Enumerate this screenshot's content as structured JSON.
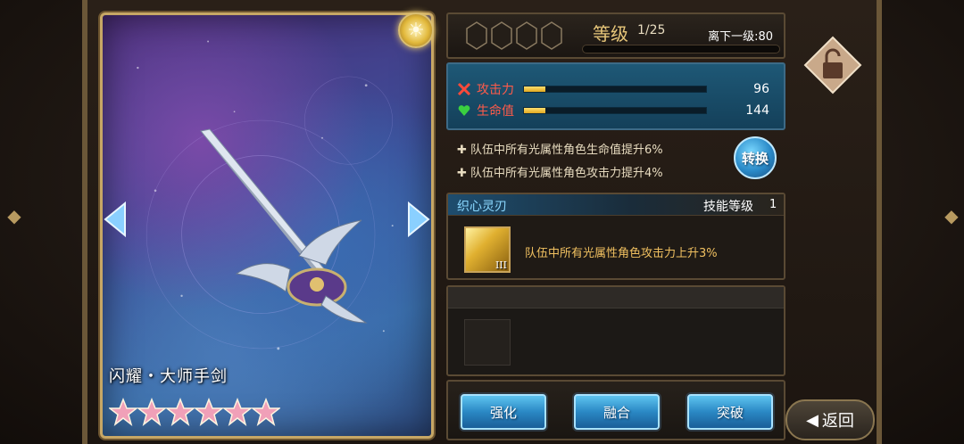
{
  "card": {
    "weapon_name": "闪耀・大师手剑",
    "rarity_stars": 6,
    "element_icon": "sun-icon",
    "sun_glyph": "☀"
  },
  "level": {
    "title": "等级",
    "value": "1/25",
    "next_level": "离下一级:80",
    "exp_fraction": 0.0,
    "rank_slots": 4
  },
  "stats": [
    {
      "label": "攻击力",
      "value": "96",
      "fill": 0.12,
      "icon": "sword-cross-icon"
    },
    {
      "label": "生命值",
      "value": "144",
      "fill": 0.12,
      "icon": "heart-icon"
    }
  ],
  "effects": [
    "队伍中所有光属性角色生命值提升6%",
    "队伍中所有光属性角色攻击力提升4%"
  ],
  "convert_label": "转换",
  "skill": {
    "name": "织心灵刃",
    "level_label": "技能等级",
    "level": "1",
    "rank": "III",
    "description": "队伍中所有光属性角色攻击力上升3%"
  },
  "actions": {
    "enhance": "强化",
    "fuse": "融合",
    "breakthrough": "突破"
  },
  "back": {
    "label": "返回",
    "arrow": "◀"
  },
  "colors": {
    "accent_gold": "#e8c77a",
    "stat_blue": "#1e5876",
    "button_blue": "#2a88c4"
  }
}
